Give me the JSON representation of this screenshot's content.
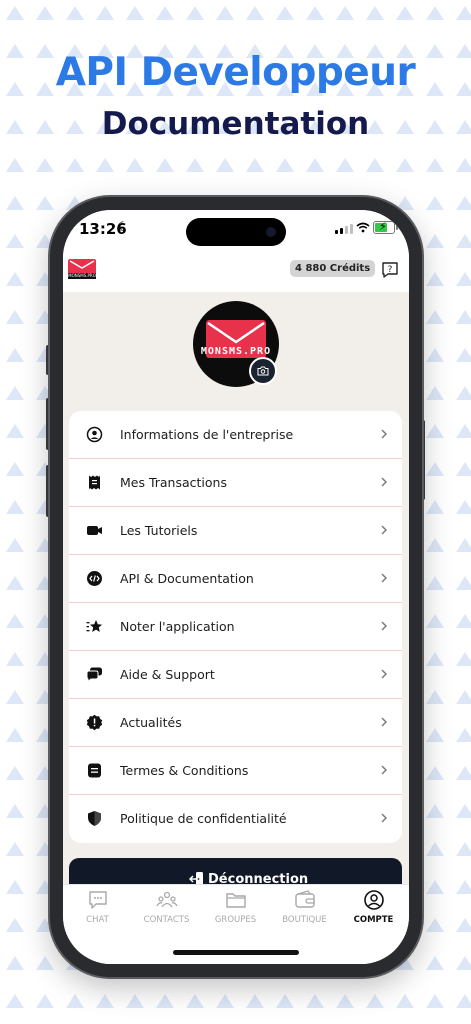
{
  "promo": {
    "title": "API Developpeur",
    "subtitle": "Documentation"
  },
  "status_bar": {
    "time": "13:26"
  },
  "header": {
    "credits": "4 880 Crédits"
  },
  "profile": {
    "brand": "MONSMS.PRO"
  },
  "menu": {
    "items": [
      {
        "label": "Informations de l'entreprise",
        "icon": "user-circle-icon"
      },
      {
        "label": "Mes Transactions",
        "icon": "receipt-icon"
      },
      {
        "label": "Les Tutoriels",
        "icon": "video-camera-icon"
      },
      {
        "label": "API & Documentation",
        "icon": "code-icon"
      },
      {
        "label": "Noter l'application",
        "icon": "star-icon"
      },
      {
        "label": "Aide & Support",
        "icon": "chat-bubbles-icon"
      },
      {
        "label": "Actualités",
        "icon": "alert-badge-icon"
      },
      {
        "label": "Termes & Conditions",
        "icon": "document-icon"
      },
      {
        "label": "Politique de confidentialité",
        "icon": "shield-icon"
      }
    ]
  },
  "logout": {
    "label": "Déconnection"
  },
  "tabs": [
    {
      "label": "CHAT",
      "icon": "chat-icon",
      "active": false
    },
    {
      "label": "CONTACTS",
      "icon": "contacts-icon",
      "active": false
    },
    {
      "label": "GROUPES",
      "icon": "folder-icon",
      "active": false
    },
    {
      "label": "BOUTIQUE",
      "icon": "wallet-icon",
      "active": false
    },
    {
      "label": "COMPTE",
      "icon": "account-icon",
      "active": true
    }
  ],
  "colors": {
    "headline_blue": "#2c7ae6",
    "headline_navy": "#151a4d",
    "brand_red": "#e8314a",
    "logout_bg": "#111827",
    "screen_bg": "#f2efeb"
  }
}
